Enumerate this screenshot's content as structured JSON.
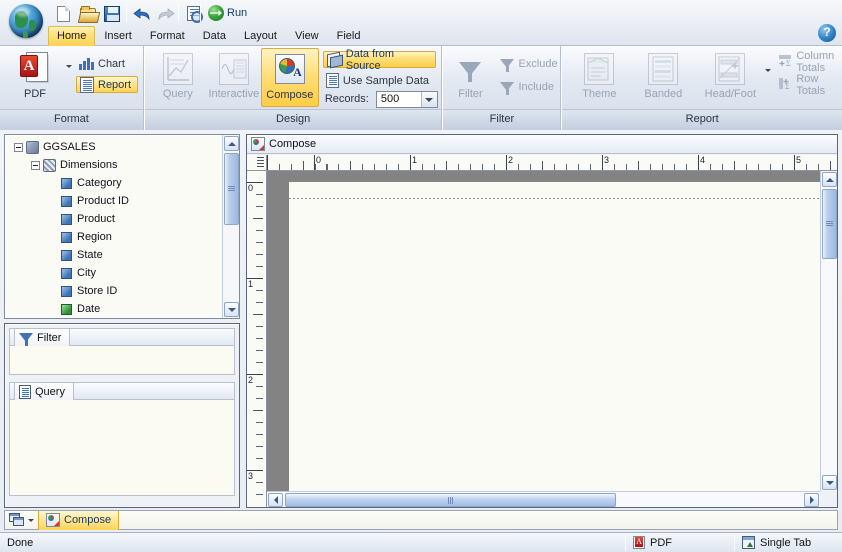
{
  "app": {
    "logo_icon": "globe-logo-icon"
  },
  "toolbar": {
    "buttons": [
      {
        "name": "new-document-button",
        "icon": "new-document-icon",
        "tooltip": "New"
      },
      {
        "name": "open-button",
        "icon": "open-folder-icon",
        "tooltip": "Open"
      },
      {
        "name": "save-button",
        "icon": "save-floppy-icon",
        "tooltip": "Save"
      },
      {
        "name": "undo-button",
        "icon": "undo-arrow-icon",
        "tooltip": "Undo"
      },
      {
        "name": "redo-button",
        "icon": "redo-arrow-icon",
        "tooltip": "Redo"
      },
      {
        "name": "preview-button",
        "icon": "document-search-icon",
        "tooltip": "Preview"
      }
    ],
    "run_label": "Run",
    "run_icon": "green-globe-arrow-icon"
  },
  "menubar": {
    "items": [
      {
        "label": "Home",
        "active": true
      },
      {
        "label": "Insert",
        "active": false
      },
      {
        "label": "Format",
        "active": false
      },
      {
        "label": "Data",
        "active": false
      },
      {
        "label": "Layout",
        "active": false
      },
      {
        "label": "View",
        "active": false
      },
      {
        "label": "Field",
        "active": false
      }
    ],
    "help_label": "?"
  },
  "ribbon": {
    "groups": [
      {
        "label": "Format",
        "pdf_label": "PDF",
        "chart_label": "Chart",
        "report_label": "Report"
      },
      {
        "label": "Design",
        "query_label": "Query",
        "interactive_label": "Interactive",
        "compose_label": "Compose",
        "data_from_source_label": "Data from Source",
        "use_sample_data_label": "Use Sample Data",
        "records_label": "Records:",
        "records_value": "500"
      },
      {
        "label": "Filter",
        "filter_label": "Filter",
        "exclude_label": "Exclude",
        "include_label": "Include"
      },
      {
        "label": "Report",
        "theme_label": "Theme",
        "banded_label": "Banded",
        "headfoot_label": "Head/Foot",
        "column_totals_label": "Column Totals",
        "row_totals_label": "Row Totals"
      }
    ]
  },
  "sidebar": {
    "tree": [
      {
        "label": "GGSALES",
        "level": 0,
        "icon": "cube-icon",
        "expander": "minus"
      },
      {
        "label": "Dimensions",
        "level": 1,
        "icon": "dimensions-cube-icon",
        "expander": "minus"
      },
      {
        "label": "Category",
        "level": 2,
        "icon": "dimension-icon"
      },
      {
        "label": "Product ID",
        "level": 2,
        "icon": "dimension-icon"
      },
      {
        "label": "Product",
        "level": 2,
        "icon": "dimension-icon"
      },
      {
        "label": "Region",
        "level": 2,
        "icon": "dimension-icon"
      },
      {
        "label": "State",
        "level": 2,
        "icon": "dimension-icon"
      },
      {
        "label": "City",
        "level": 2,
        "icon": "dimension-icon"
      },
      {
        "label": "Store ID",
        "level": 2,
        "icon": "dimension-icon"
      },
      {
        "label": "Date",
        "level": 2,
        "icon": "dimension-date-icon"
      }
    ],
    "filter_tab_label": "Filter",
    "query_tab_label": "Query"
  },
  "compose": {
    "title": "Compose",
    "ruler_h_labels": [
      "0",
      "1",
      "2",
      "3",
      "4",
      "5"
    ],
    "ruler_v_labels": [
      "0",
      "1",
      "2",
      "3"
    ]
  },
  "tabbar": {
    "tab_label": "Compose",
    "tab_icon": "compose-icon",
    "windows_icon": "window-list-icon"
  },
  "statusbar": {
    "status_text": "Done",
    "format_label": "PDF",
    "format_icon": "pdf-icon",
    "tab_mode_label": "Single Tab",
    "tab_mode_icon": "single-tab-icon"
  },
  "colors": {
    "accent_yellow": "#ffd352",
    "accent_border": "#d9ab3d",
    "canvas_gray": "#838383",
    "page_white": "#fbfbf6",
    "scrollbar_blue": "#9bb8e4"
  }
}
